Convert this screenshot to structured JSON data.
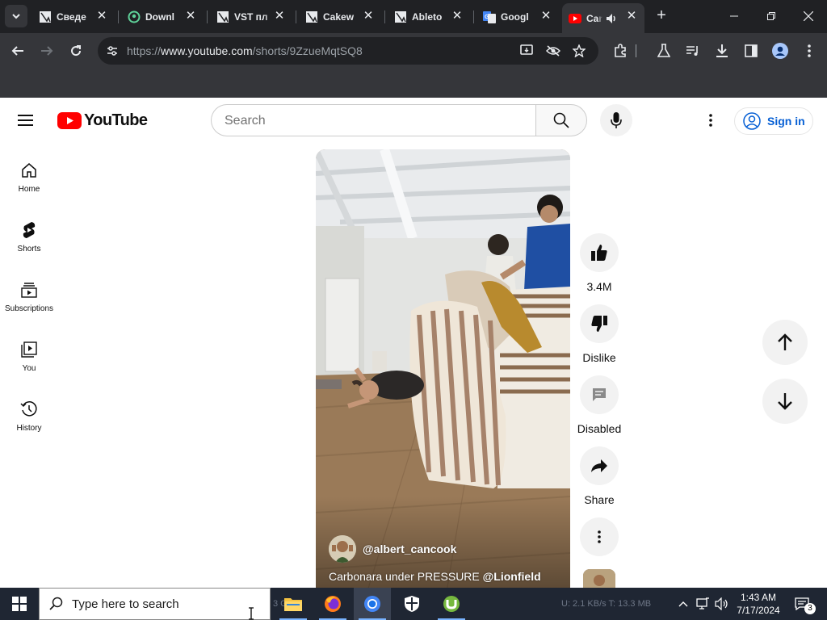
{
  "browser": {
    "tabs": [
      {
        "title": "Сведе",
        "icon": "generic-page-icon"
      },
      {
        "title": "Downl",
        "icon": "download-site-icon"
      },
      {
        "title": "VST пл",
        "icon": "generic-page-icon"
      },
      {
        "title": "Cakew",
        "icon": "generic-page-icon"
      },
      {
        "title": "Ableto",
        "icon": "generic-page-icon"
      },
      {
        "title": "Googl",
        "icon": "google-translate-icon"
      },
      {
        "title": "Car",
        "icon": "youtube-icon",
        "active": true,
        "audio": true
      }
    ],
    "url_prefix": "https://",
    "url_host": "www.youtube.com",
    "url_path": "/shorts/9ZzueMqtSQ8"
  },
  "youtube": {
    "logo_text": "YouTube",
    "search_placeholder": "Search",
    "sign_in_label": "Sign in",
    "guide": [
      {
        "label": "Home",
        "icon": "home-icon"
      },
      {
        "label": "Shorts",
        "icon": "shorts-icon"
      },
      {
        "label": "Subscriptions",
        "icon": "subscriptions-icon"
      },
      {
        "label": "You",
        "icon": "you-icon"
      },
      {
        "label": "History",
        "icon": "history-icon"
      }
    ],
    "short": {
      "channel": "@albert_cancook",
      "title_text": "Carbonara under PRESSURE ",
      "title_mention": "@Lionfield"
    },
    "actions": {
      "like_label": "3.4M",
      "dislike_label": "Dislike",
      "comments_label": "Disabled",
      "share_label": "Share"
    }
  },
  "taskbar": {
    "search_placeholder": "Type here to search",
    "time": "1:43 AM",
    "date": "7/17/2024",
    "notification_count": "3",
    "ghost_text_1": "3 GB",
    "ghost_text_2": "U: 2.1 KB/s T: 13.3 MB"
  }
}
